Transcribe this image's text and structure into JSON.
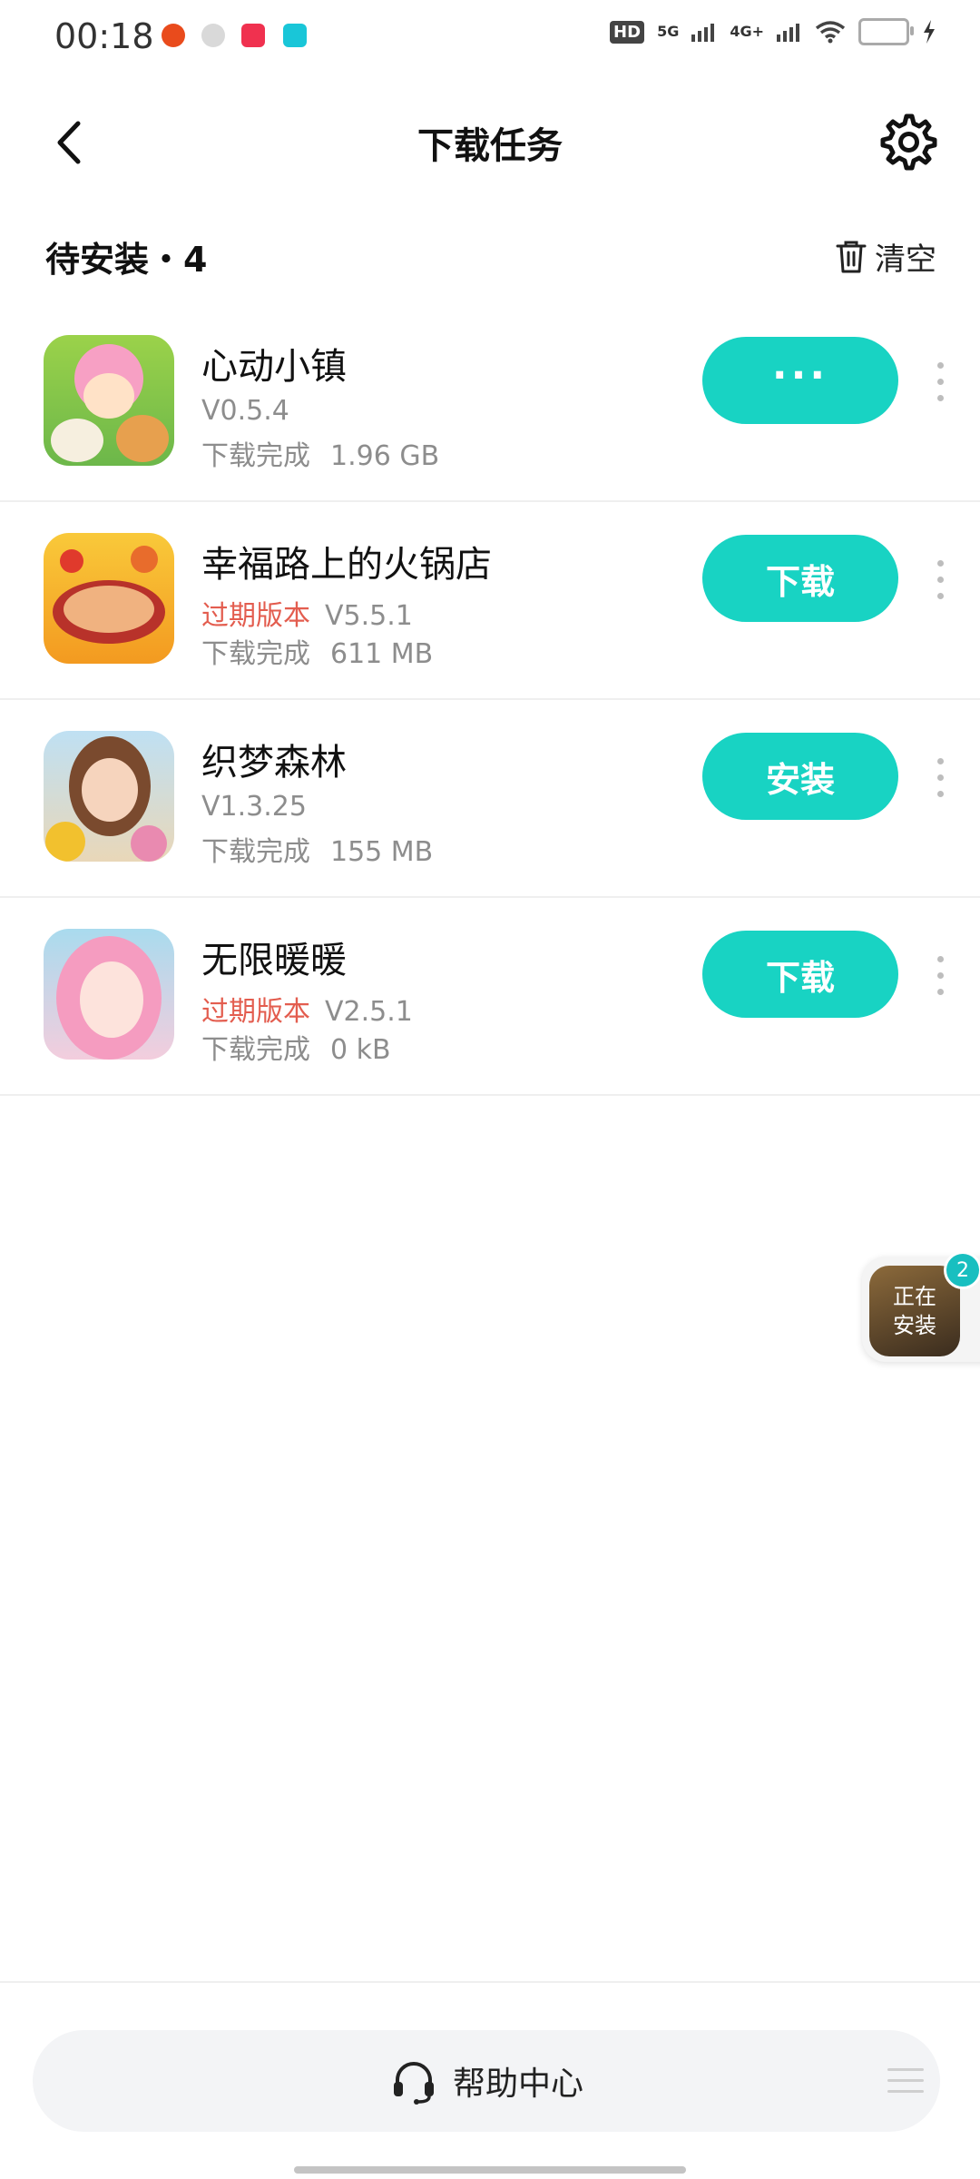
{
  "status_bar": {
    "time": "00:18",
    "hd": "HD",
    "net1": "5G",
    "net2": "4G+",
    "notifications": [
      "app-notif-icon-1",
      "app-notif-icon-2",
      "app-notif-icon-3",
      "app-notif-icon-4"
    ]
  },
  "header": {
    "title": "下载任务"
  },
  "section": {
    "label": "待安装・4",
    "clear_label": "清空"
  },
  "items": [
    {
      "name": "心动小镇",
      "expired_label": "",
      "version": "V0.5.4",
      "status": "下载完成",
      "size": "1.96 GB",
      "action": "···"
    },
    {
      "name": "幸福路上的火锅店",
      "expired_label": "过期版本",
      "version": "V5.5.1",
      "status": "下载完成",
      "size": "611 MB",
      "action": "下载"
    },
    {
      "name": "织梦森林",
      "expired_label": "",
      "version": "V1.3.25",
      "status": "下载完成",
      "size": "155 MB",
      "action": "安装"
    },
    {
      "name": "无限暖暖",
      "expired_label": "过期版本",
      "version": "V2.5.1",
      "status": "下载完成",
      "size": "0 kB",
      "action": "下载"
    }
  ],
  "floating": {
    "label": "正在安装",
    "badge": "2"
  },
  "bottom": {
    "help_label": "帮助中心"
  },
  "colors": {
    "accent": "#18d3c3",
    "expired": "#e35d4f"
  }
}
